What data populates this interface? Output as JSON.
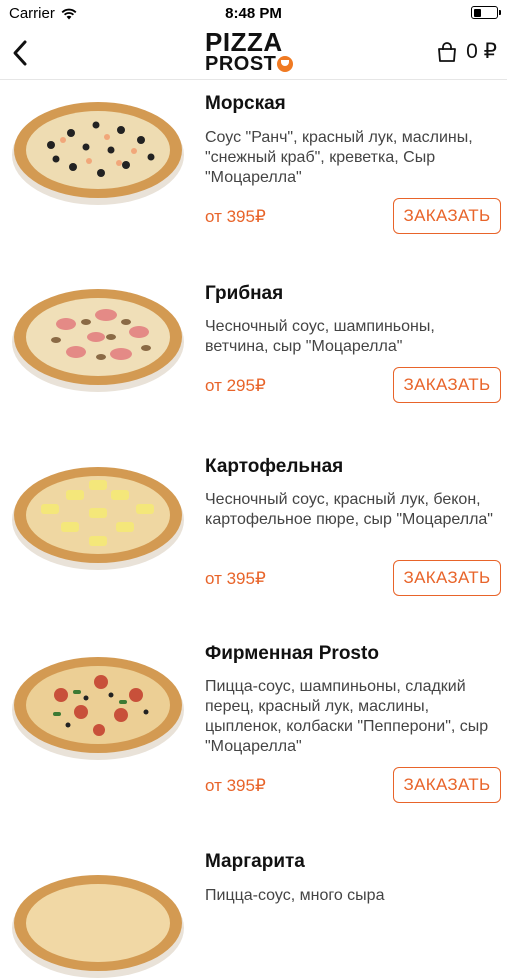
{
  "status": {
    "carrier": "Carrier",
    "time": "8:48 PM"
  },
  "header": {
    "logo_line1": "PIZZA",
    "logo_line2": "PROST",
    "cart_amount": "0 ₽"
  },
  "products": [
    {
      "name": "Морская",
      "description": "Соус \"Ранч\", красный лук, маслины, \"снежный краб\", креветка, Сыр \"Моцарелла\"",
      "price": "от 395₽",
      "order_label": "ЗАКАЗАТЬ"
    },
    {
      "name": "Грибная",
      "description": "Чесночный соус, шампиньоны, ветчина, сыр \"Моцарелла\"",
      "price": "от 295₽",
      "order_label": "ЗАКАЗАТЬ"
    },
    {
      "name": "Картофельная",
      "description": "Чесночный соус, красный лук, бекон, картофельное пюре, сыр \"Моцарелла\"",
      "price": "от 395₽",
      "order_label": "ЗАКАЗАТЬ"
    },
    {
      "name": "Фирменная Prosto",
      "description": "Пицца-соус, шампиньоны, сладкий перец, красный лук, маслины, цыпленок, колбаски \"Пепперони\", сыр \"Моцарелла\"",
      "price": "от 395₽",
      "order_label": "ЗАКАЗАТЬ"
    },
    {
      "name": "Маргарита",
      "description": "Пицца-соус, много сыра",
      "price": "",
      "order_label": ""
    }
  ],
  "colors": {
    "accent": "#e8642a",
    "crust": "#d9a35c",
    "cheese": "#f3d9a0"
  }
}
